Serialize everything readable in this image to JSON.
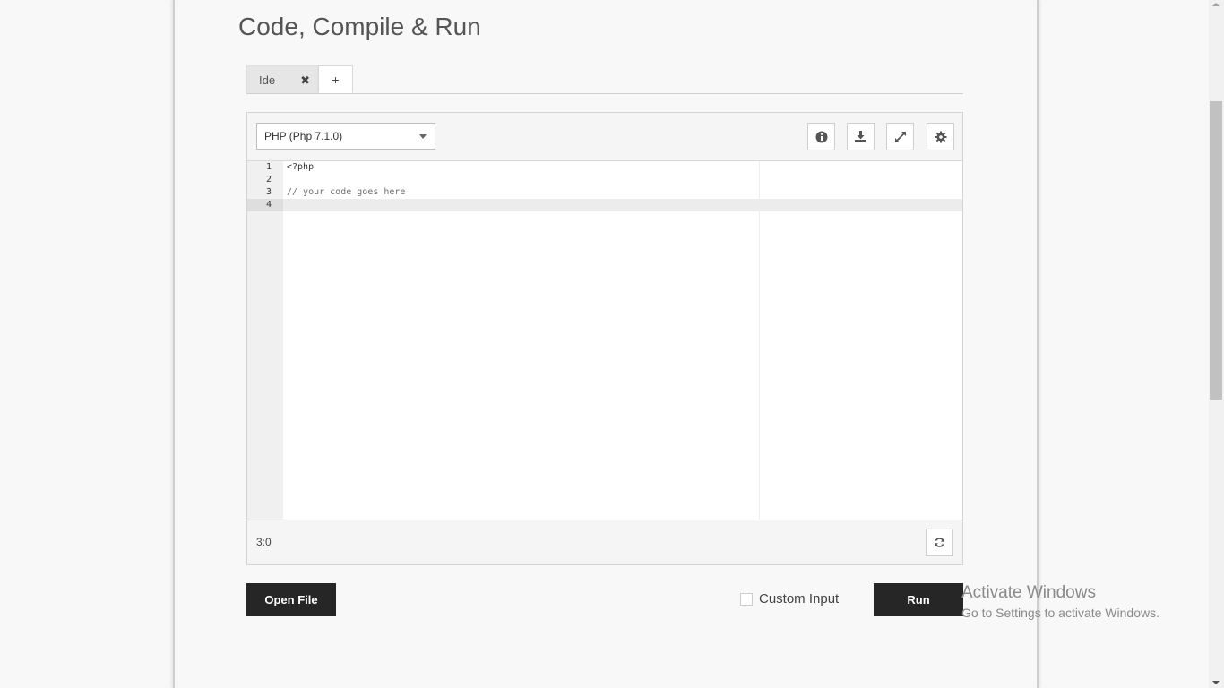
{
  "page": {
    "title": "Code, Compile & Run"
  },
  "tabs": [
    {
      "label": "Ide",
      "close": "✖"
    },
    {
      "label": "+"
    }
  ],
  "editor": {
    "language": "PHP (Php 7.1.0)",
    "toolbar": [
      "info-icon",
      "download-icon",
      "expand-icon",
      "settings-icon"
    ],
    "lines": [
      {
        "number": "1",
        "text": "<?php"
      },
      {
        "number": "2",
        "text": ""
      },
      {
        "number": "3",
        "text": "// your code goes here"
      },
      {
        "number": "4",
        "text": ""
      }
    ],
    "active_line": 4,
    "cursor_position": "3:0"
  },
  "actions": {
    "open_file": "Open File",
    "custom_input": "Custom Input",
    "custom_input_checked": false,
    "run": "Run"
  },
  "watermark": {
    "title": "Activate Windows",
    "subtitle": "Go to Settings to activate Windows."
  },
  "colors": {
    "button_dark": "#262626",
    "page_bg": "#f8f8f8"
  }
}
